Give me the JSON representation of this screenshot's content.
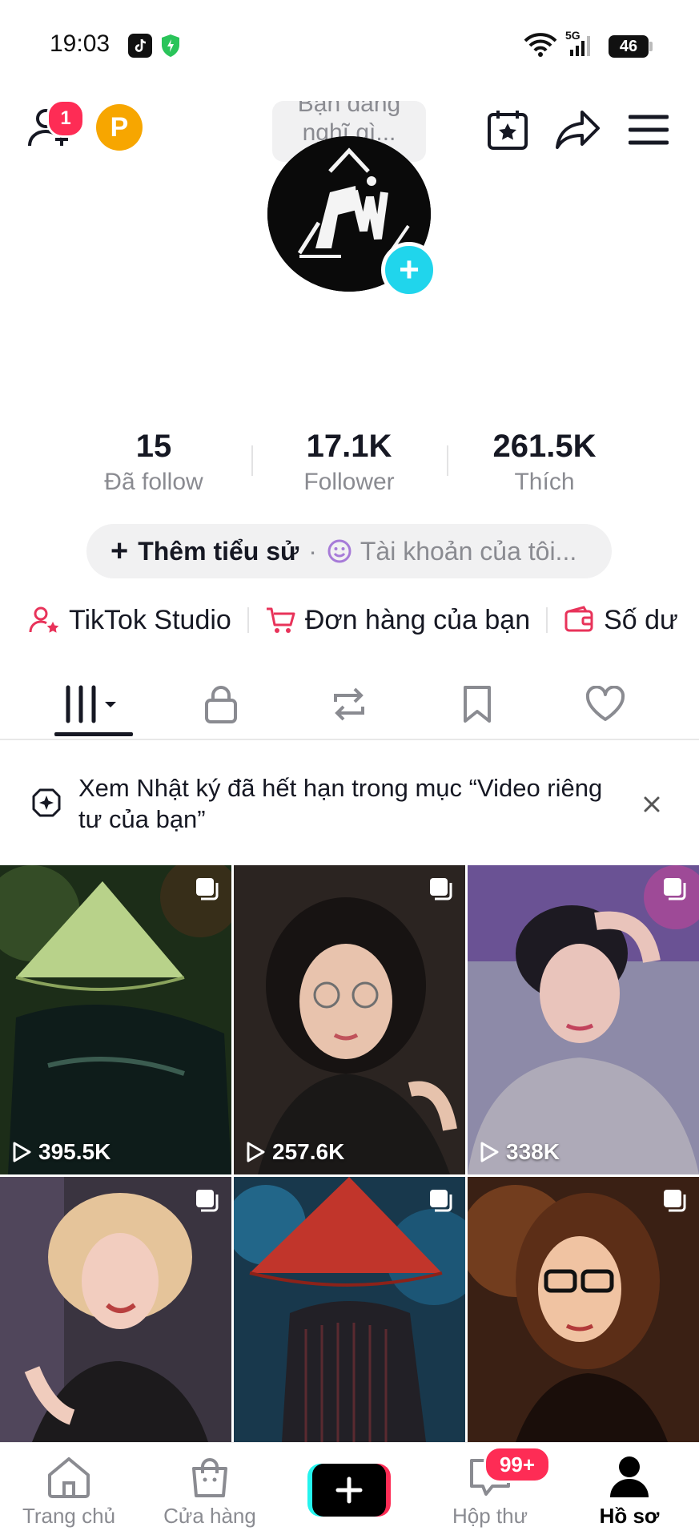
{
  "status_bar": {
    "time": "19:03",
    "network": "5G",
    "battery": "46"
  },
  "header": {
    "friend_badge": "1",
    "points_label": "P",
    "bubble_text": "Bạn đang nghĩ gì..."
  },
  "stats": [
    {
      "value": "15",
      "label": "Đã follow"
    },
    {
      "value": "17.1K",
      "label": "Follower"
    },
    {
      "value": "261.5K",
      "label": "Thích"
    }
  ],
  "bio": {
    "add_label": "Thêm tiểu sử",
    "separator": "·",
    "account_label": "Tài khoản của tôi..."
  },
  "tools": [
    {
      "label": "TikTok Studio",
      "icon": "user-star-icon"
    },
    {
      "label": "Đơn hàng của bạn",
      "icon": "cart-icon"
    },
    {
      "label": "Số dư",
      "icon": "wallet-icon"
    }
  ],
  "tabs": [
    "videos-grid-icon",
    "lock-icon",
    "repost-icon",
    "bookmark-icon",
    "heart-icon"
  ],
  "notice": {
    "text": "Xem Nhật ký đã hết hạn trong mục “Video riêng tư của bạn”"
  },
  "videos": [
    {
      "views": "395.5K"
    },
    {
      "views": "257.6K"
    },
    {
      "views": "338K"
    },
    {
      "views": ""
    },
    {
      "views": ""
    },
    {
      "views": ""
    }
  ],
  "nav": {
    "home": "Trang chủ",
    "shop": "Cửa hàng",
    "inbox": "Hộp thư",
    "inbox_badge": "99+",
    "profile": "Hồ sơ"
  },
  "colors": {
    "accent_red": "#fe2c55",
    "accent_cyan": "#20d5ec",
    "points_orange": "#f7a600"
  }
}
